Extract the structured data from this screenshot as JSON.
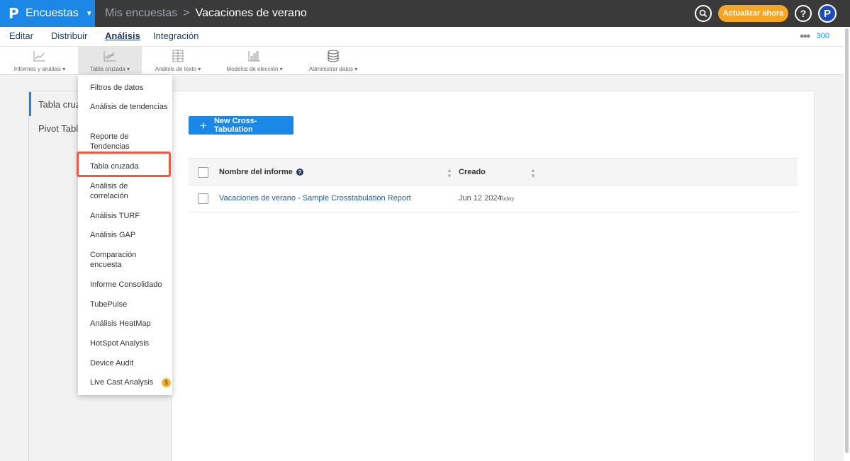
{
  "topbar": {
    "brand_logo": "P",
    "brand_name": "Encuestas",
    "breadcrumb_link": "Mis encuestas",
    "breadcrumb_sep": ">",
    "breadcrumb_current": "Vacaciones de verano",
    "upgrade_label": "Actualizar ahora",
    "help_label": "?",
    "avatar_letter": "P",
    "accent_color": "#1b87e6",
    "upgrade_color": "#f6a623"
  },
  "nav": {
    "tabs": [
      {
        "label": "Editar"
      },
      {
        "label": "Distribuir"
      },
      {
        "label": "Análisis"
      },
      {
        "label": "Integración"
      }
    ],
    "active_tab": "Análisis",
    "users_count": "300"
  },
  "toolbar": {
    "items": [
      {
        "label": "Informes y análisis",
        "icon": "line-chart-icon"
      },
      {
        "label": "Tabla cruzada",
        "icon": "crosstab-chart-icon"
      },
      {
        "label": "Análisis de texto",
        "icon": "text-grid-icon"
      },
      {
        "label": "Modelos de elección",
        "icon": "bar-chart-icon"
      },
      {
        "label": "Administrar datos",
        "icon": "database-icon"
      }
    ],
    "active_item": "Tabla cruzada"
  },
  "side": {
    "items": [
      {
        "label": "Tabla cruzada"
      },
      {
        "label": "Pivot Table"
      }
    ]
  },
  "main": {
    "new_button": "New Cross-Tabulation",
    "table": {
      "col_name": "Nombre del informe",
      "col_created": "Creado",
      "rows": [
        {
          "name": "Vacaciones de verano - Sample Crosstabulation Report",
          "date": "Jun 12 2024",
          "relative": "Today"
        }
      ]
    }
  },
  "dropdown": {
    "items": [
      {
        "label": "Filtros de datos"
      },
      {
        "label": "Análisis de tendencias"
      },
      {
        "label": "Reporte de Tendencias"
      },
      {
        "label": "Tabla cruzada"
      },
      {
        "label": "Análisis de correlación"
      },
      {
        "label": "Análisis TURF"
      },
      {
        "label": "Análisis GAP"
      },
      {
        "label": "Comparación encuesta"
      },
      {
        "label": "Informe Consolidado"
      },
      {
        "label": "TubePulse"
      },
      {
        "label": "Análisis HeatMap"
      },
      {
        "label": "HotSpot Analysis"
      },
      {
        "label": "Device Audit"
      },
      {
        "label": "Live Cast Analysis"
      }
    ],
    "highlighted_item": "Tabla cruzada",
    "highlight_color": "#ee5a45"
  }
}
